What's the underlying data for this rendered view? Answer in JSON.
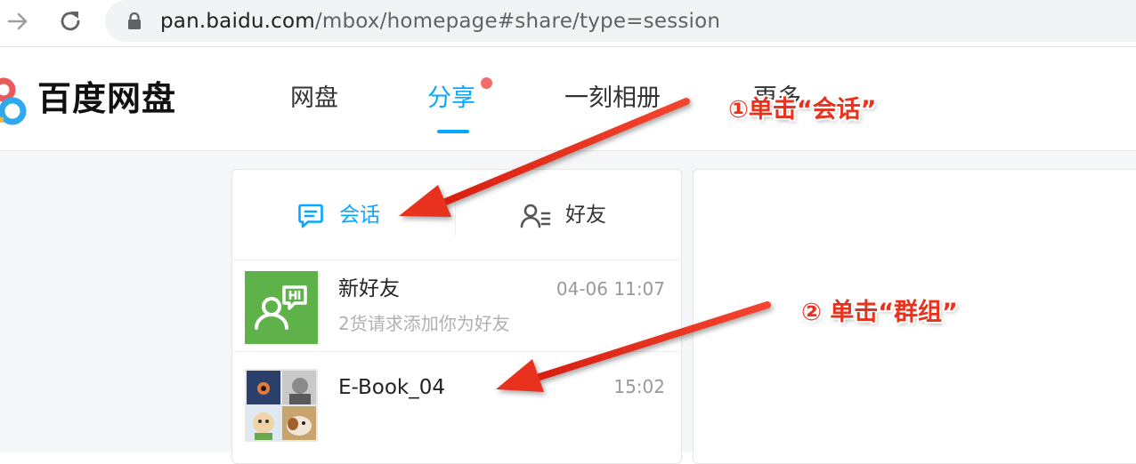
{
  "browser": {
    "url_host": "pan.baidu.com",
    "url_path": "/mbox/homepage#share/type=session"
  },
  "header": {
    "logo_text": "百度网盘",
    "nav": [
      {
        "label": "网盘",
        "active": false
      },
      {
        "label": "分享",
        "active": true,
        "has_dot": true
      },
      {
        "label": "一刻相册",
        "active": false
      },
      {
        "label": "更多",
        "active": false
      }
    ]
  },
  "panel": {
    "tabs": [
      {
        "label": "会话",
        "icon": "chat-icon",
        "active": true
      },
      {
        "label": "好友",
        "icon": "friends-list-icon",
        "active": false
      }
    ],
    "conversations": [
      {
        "title": "新好友",
        "subtitle": "2货请求添加你为好友",
        "time": "04-06 11:07",
        "avatar": "new-friend-avatar"
      },
      {
        "title": "E-Book_04",
        "subtitle": "",
        "time": "15:02",
        "avatar": "group-avatar"
      }
    ]
  },
  "annotations": {
    "step1": "①单击“会话”",
    "step2": "② 单击“群组”"
  },
  "colors": {
    "accent": "#06a7ff",
    "annotation_red": "#e8321d",
    "new_friend_green": "#5fb24a",
    "badge_red": "#f56c6c"
  }
}
